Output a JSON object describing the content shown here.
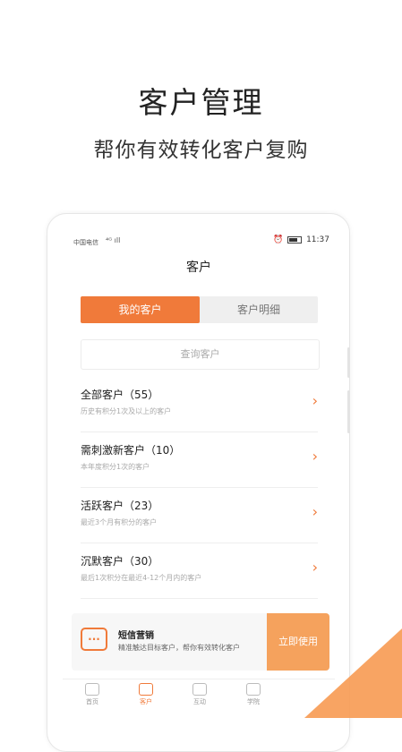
{
  "hero": {
    "title": "客户管理",
    "subtitle": "帮你有效转化客户复购"
  },
  "status": {
    "carrier": "中国电信",
    "signal": "⁴ᴳ ıll",
    "time": "11:37"
  },
  "page_title": "客户",
  "tabs": {
    "mine": "我的客户",
    "detail": "客户明细"
  },
  "search": {
    "placeholder": "查询客户"
  },
  "rows": [
    {
      "name": "全部客户（55）",
      "desc": "历史有积分1次及以上的客户"
    },
    {
      "name": "需刺激新客户（10）",
      "desc": "本年度积分1次的客户"
    },
    {
      "name": "活跃客户（23）",
      "desc": "最近3个月有积分的客户"
    },
    {
      "name": "沉默客户（30）",
      "desc": "最后1次积分在最近4-12个月内的客户"
    }
  ],
  "banner": {
    "title": "短信营销",
    "desc": "精准触达目标客户，帮你有效转化客户",
    "cta": "立即使用"
  },
  "tabbar": [
    {
      "label": "首页"
    },
    {
      "label": "客户"
    },
    {
      "label": "互动"
    },
    {
      "label": "学院"
    }
  ],
  "colors": {
    "accent": "#f07a3a"
  }
}
